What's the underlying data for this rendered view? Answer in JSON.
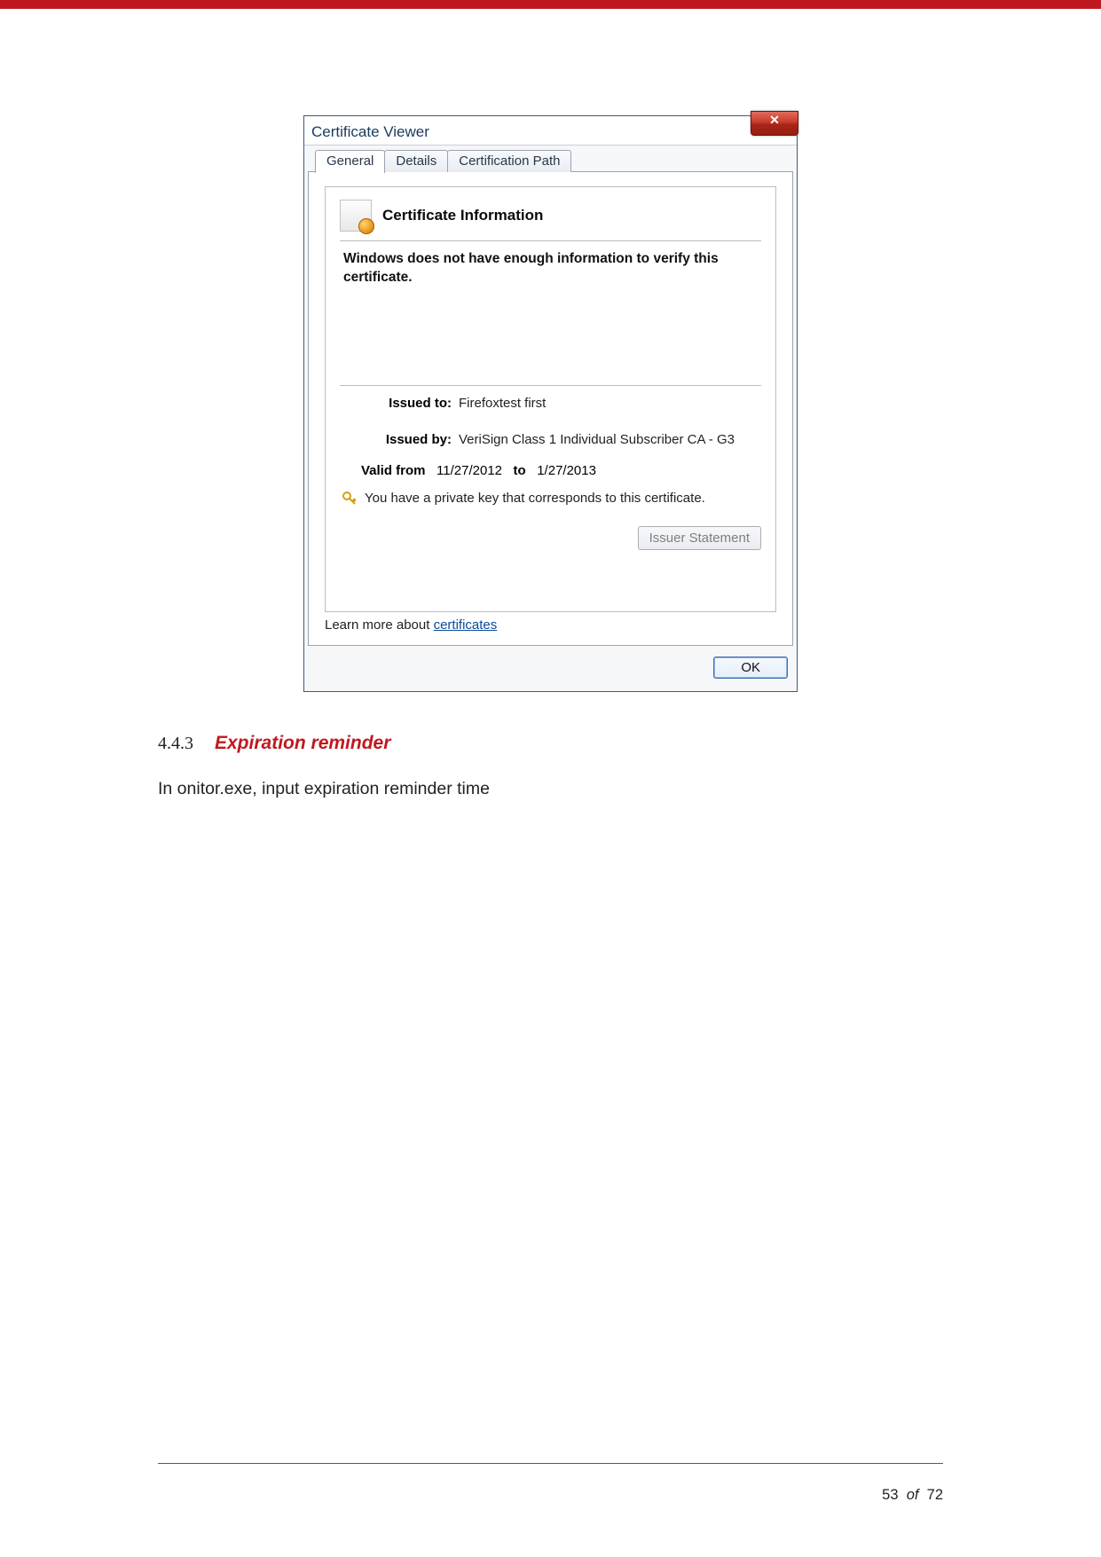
{
  "dialog": {
    "title": "Certificate Viewer",
    "tabs": {
      "general": "General",
      "details": "Details",
      "path": "Certification Path"
    },
    "info_heading": "Certificate Information",
    "info_message": "Windows does not have enough information to verify this certificate.",
    "issued_to_label": "Issued to:",
    "issued_to_value": "Firefoxtest first",
    "issued_by_label": "Issued by:",
    "issued_by_value": "VeriSign Class 1 Individual Subscriber CA - G3",
    "valid_from_label": "Valid from",
    "valid_from_value": "11/27/2012",
    "valid_to_label": "to",
    "valid_to_value": "1/27/2013",
    "private_key_note": "You have a private key that corresponds to this certificate.",
    "issuer_statement_btn": "Issuer Statement",
    "learn_prefix": "Learn more about ",
    "learn_link": "certificates",
    "ok_btn": "OK"
  },
  "section": {
    "number": "4.4.3",
    "title": "Expiration reminder",
    "body": "In onitor.exe, input expiration reminder time"
  },
  "footer": {
    "current": "53",
    "of_word": "of",
    "total": "72"
  }
}
